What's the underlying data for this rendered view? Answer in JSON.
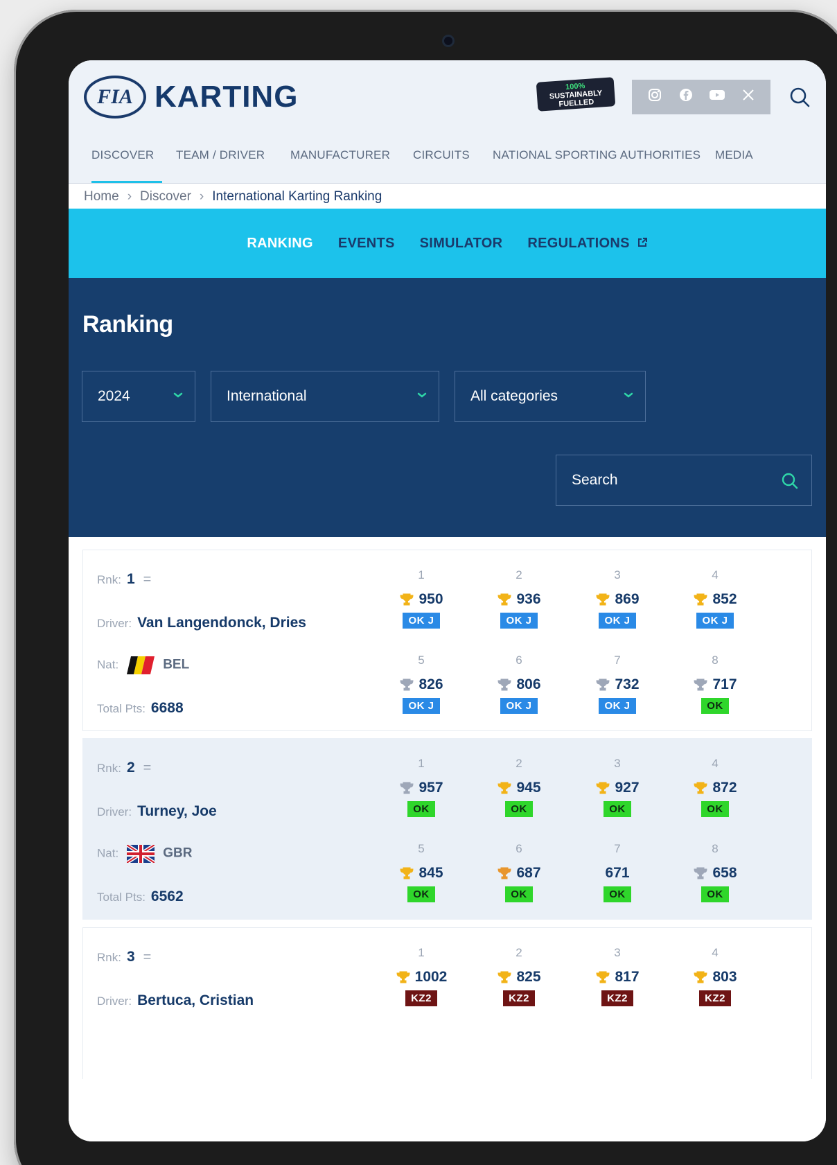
{
  "colors": {
    "accent_cyan": "#1cc2eb",
    "navy": "#173e6d",
    "tag_okj": "#2a8ae6",
    "tag_ok": "#2fd62b",
    "tag_kz2": "#6e1414",
    "trophy_gold": "#f2b318",
    "trophy_silver": "#9ea7b8"
  },
  "header": {
    "logo_badge": "FIA",
    "logo_text": "KARTING",
    "sustainable_line1": "100%",
    "sustainable_line2": "SUSTAINABLY",
    "sustainable_line3": "FUELLED",
    "social_icons": [
      "instagram-icon",
      "facebook-icon",
      "youtube-icon",
      "x-icon"
    ],
    "search_icon": "search-icon"
  },
  "nav": {
    "items": [
      "DISCOVER",
      "TEAM / DRIVER",
      "MANUFACTURER",
      "CIRCUITS",
      "NATIONAL SPORTING AUTHORITIES",
      "MEDIA"
    ],
    "active": "DISCOVER"
  },
  "breadcrumb": {
    "home": "Home",
    "discover": "Discover",
    "current": "International Karting Ranking"
  },
  "subnav": {
    "tabs": [
      "RANKING",
      "EVENTS",
      "SIMULATOR",
      "REGULATIONS"
    ],
    "active": "RANKING",
    "external_icon": "external-link-icon"
  },
  "filters": {
    "title": "Ranking",
    "year": "2024",
    "type": "International",
    "category": "All categories",
    "search_placeholder": "Search"
  },
  "labels": {
    "rank": "Rnk:",
    "driver": "Driver:",
    "nat": "Nat:",
    "total": "Total Pts:",
    "trend": "="
  },
  "rankings": [
    {
      "rank": "1",
      "driver": "Van Langendonck, Dries",
      "nat": "BEL",
      "flag": "belgium-flag",
      "total": "6688",
      "results": [
        {
          "n": "1",
          "pts": "950",
          "trophy": "gold",
          "cat": "OK J"
        },
        {
          "n": "2",
          "pts": "936",
          "trophy": "gold",
          "cat": "OK J"
        },
        {
          "n": "3",
          "pts": "869",
          "trophy": "gold",
          "cat": "OK J"
        },
        {
          "n": "4",
          "pts": "852",
          "trophy": "gold",
          "cat": "OK J"
        },
        {
          "n": "5",
          "pts": "826",
          "trophy": "silver",
          "cat": "OK J"
        },
        {
          "n": "6",
          "pts": "806",
          "trophy": "silver",
          "cat": "OK J"
        },
        {
          "n": "7",
          "pts": "732",
          "trophy": "silver",
          "cat": "OK J"
        },
        {
          "n": "8",
          "pts": "717",
          "trophy": "silver",
          "cat": "OK"
        }
      ]
    },
    {
      "rank": "2",
      "driver": "Turney, Joe",
      "nat": "GBR",
      "flag": "uk-flag",
      "total": "6562",
      "results": [
        {
          "n": "1",
          "pts": "957",
          "trophy": "silver",
          "cat": "OK"
        },
        {
          "n": "2",
          "pts": "945",
          "trophy": "gold",
          "cat": "OK"
        },
        {
          "n": "3",
          "pts": "927",
          "trophy": "gold",
          "cat": "OK"
        },
        {
          "n": "4",
          "pts": "872",
          "trophy": "gold",
          "cat": "OK"
        },
        {
          "n": "5",
          "pts": "845",
          "trophy": "gold",
          "cat": "OK"
        },
        {
          "n": "6",
          "pts": "687",
          "trophy": "bronze",
          "cat": "OK"
        },
        {
          "n": "7",
          "pts": "671",
          "trophy": "none",
          "cat": "OK"
        },
        {
          "n": "8",
          "pts": "658",
          "trophy": "silver",
          "cat": "OK"
        }
      ]
    },
    {
      "rank": "3",
      "driver": "Bertuca, Cristian",
      "nat": "",
      "flag": "",
      "total": "",
      "results": [
        {
          "n": "1",
          "pts": "1002",
          "trophy": "gold",
          "cat": "KZ2"
        },
        {
          "n": "2",
          "pts": "825",
          "trophy": "gold",
          "cat": "KZ2"
        },
        {
          "n": "3",
          "pts": "817",
          "trophy": "gold",
          "cat": "KZ2"
        },
        {
          "n": "4",
          "pts": "803",
          "trophy": "gold",
          "cat": "KZ2"
        }
      ]
    }
  ]
}
